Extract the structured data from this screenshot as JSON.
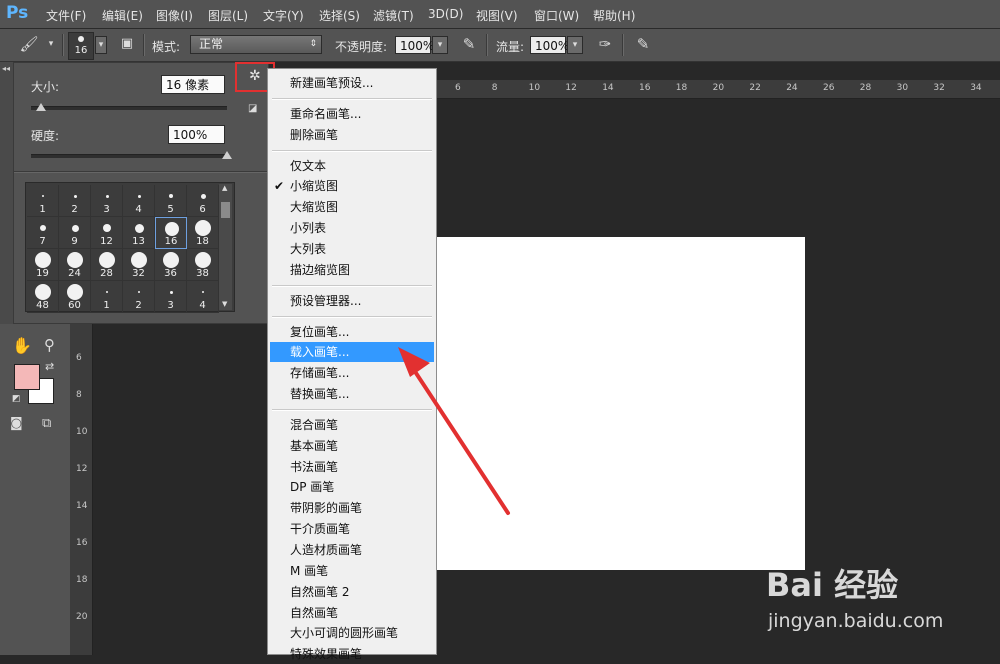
{
  "app": {
    "logo": "Ps"
  },
  "menubar": {
    "items": [
      "文件(F)",
      "编辑(E)",
      "图像(I)",
      "图层(L)",
      "文字(Y)",
      "选择(S)",
      "滤镜(T)",
      "3D(D)",
      "视图(V)",
      "窗口(W)",
      "帮助(H)"
    ]
  },
  "options": {
    "brush_size": "16",
    "mode_label": "模式:",
    "mode_value": "正常",
    "opacity_label": "不透明度:",
    "opacity_value": "100%",
    "flow_label": "流量:",
    "flow_value": "100%"
  },
  "brush_panel": {
    "size_label": "大小:",
    "size_value": "16 像素",
    "size_fraction": 0.05,
    "hardness_label": "硬度:",
    "hardness_value": "100%",
    "hardness_fraction": 1.0,
    "presets": [
      {
        "n": "1"
      },
      {
        "n": "2"
      },
      {
        "n": "3"
      },
      {
        "n": "4"
      },
      {
        "n": "5"
      },
      {
        "n": "6"
      },
      {
        "n": "7"
      },
      {
        "n": "9"
      },
      {
        "n": "12"
      },
      {
        "n": "13"
      },
      {
        "n": "16"
      },
      {
        "n": "18"
      },
      {
        "n": "19"
      },
      {
        "n": "24"
      },
      {
        "n": "28"
      },
      {
        "n": "32"
      },
      {
        "n": "36"
      },
      {
        "n": "38"
      },
      {
        "n": "48"
      },
      {
        "n": "60"
      },
      {
        "n": "1"
      },
      {
        "n": "2"
      },
      {
        "n": "3"
      },
      {
        "n": "4"
      }
    ],
    "selected": "16"
  },
  "context_menu": {
    "groups": [
      [
        "新建画笔预设..."
      ],
      [
        "重命名画笔...",
        "删除画笔"
      ],
      [
        "仅文本",
        "小缩览图",
        "大缩览图",
        "小列表",
        "大列表",
        "描边缩览图"
      ],
      [
        "预设管理器..."
      ],
      [
        "复位画笔...",
        "载入画笔...",
        "存储画笔...",
        "替换画笔..."
      ],
      [
        "混合画笔",
        "基本画笔",
        "书法画笔",
        "DP 画笔",
        "带阴影的画笔",
        "干介质画笔",
        "人造材质画笔",
        "M 画笔",
        "自然画笔 2",
        "自然画笔",
        "大小可调的圆形画笔",
        "特殊效果画笔"
      ]
    ],
    "checked": "小缩览图",
    "highlighted": "载入画笔..."
  },
  "ruler_top": [
    "6",
    "8",
    "10",
    "12",
    "14",
    "16",
    "18",
    "20",
    "22",
    "24",
    "26",
    "28",
    "30",
    "32",
    "34"
  ],
  "ruler_left": [
    "6",
    "8",
    "10",
    "12",
    "14",
    "16",
    "18",
    "20"
  ],
  "colors": {
    "foreground": "#f4b8b8",
    "background": "#ffffff",
    "highlight": "#3399ff",
    "annotation": "#e23030"
  },
  "watermark": {
    "logo": "Bai 经验",
    "url": "jingyan.baidu.com"
  }
}
